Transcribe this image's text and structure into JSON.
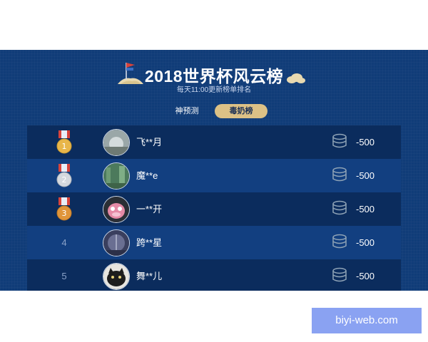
{
  "header": {
    "title": "2018世界杯风云榜",
    "subtitle": "每天11:00更新榜单排名"
  },
  "tabs": [
    {
      "label": "神预测",
      "active": false
    },
    {
      "label": "毒奶榜",
      "active": true
    }
  ],
  "leaderboard": [
    {
      "rank": "1",
      "medal": "gold",
      "name": "飞**月",
      "score": "-500"
    },
    {
      "rank": "2",
      "medal": "silver",
      "name": "魔**e",
      "score": "-500"
    },
    {
      "rank": "3",
      "medal": "bronze",
      "name": "一**开",
      "score": "-500"
    },
    {
      "rank": "4",
      "medal": null,
      "name": "跨**星",
      "score": "-500"
    },
    {
      "rank": "5",
      "medal": null,
      "name": "舞**儿",
      "score": "-500"
    }
  ],
  "watermark": "biyi-web.com",
  "colors": {
    "panel_bg": "#103c78",
    "row_dark": "#0b2c5d",
    "row_light": "#123f80",
    "tab_active": "#dcc186",
    "gold": "#e8b64a",
    "silver": "#d4d8de",
    "bronze": "#e0953a"
  },
  "icons": [
    "flag-icon",
    "cloud-icon",
    "medal-icon",
    "coin-stack-icon"
  ]
}
